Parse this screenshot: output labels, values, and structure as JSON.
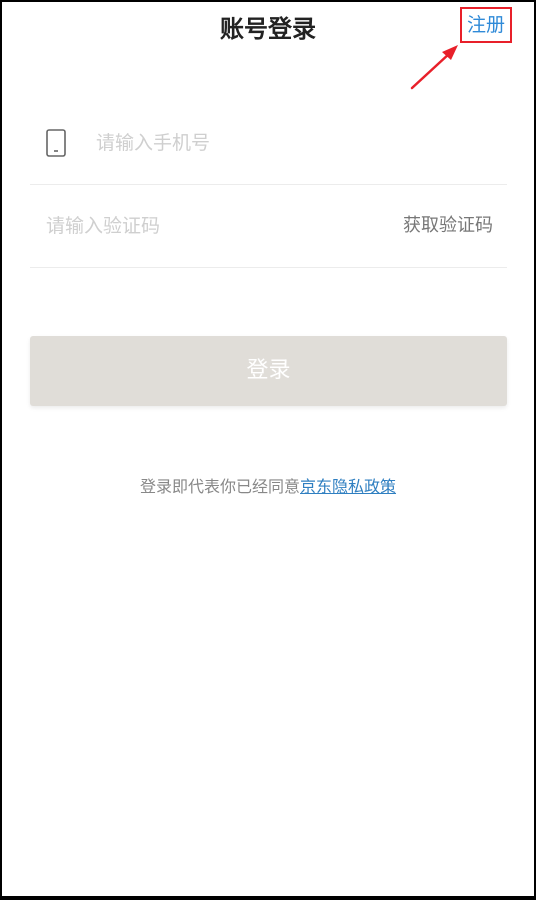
{
  "header": {
    "title": "账号登录",
    "register_label": "注册"
  },
  "form": {
    "phone_placeholder": "请输入手机号",
    "code_placeholder": "请输入验证码",
    "get_code_label": "获取验证码",
    "login_label": "登录"
  },
  "agreement": {
    "prefix": "登录即代表你已经同意",
    "link_text": "京东隐私政策"
  },
  "icons": {
    "phone": "mobile-phone-icon"
  },
  "colors": {
    "accent_blue": "#2f8ad8",
    "link_blue": "#2f7fc1",
    "highlight_red": "#e8202a",
    "button_disabled": "#e0ddd8"
  }
}
